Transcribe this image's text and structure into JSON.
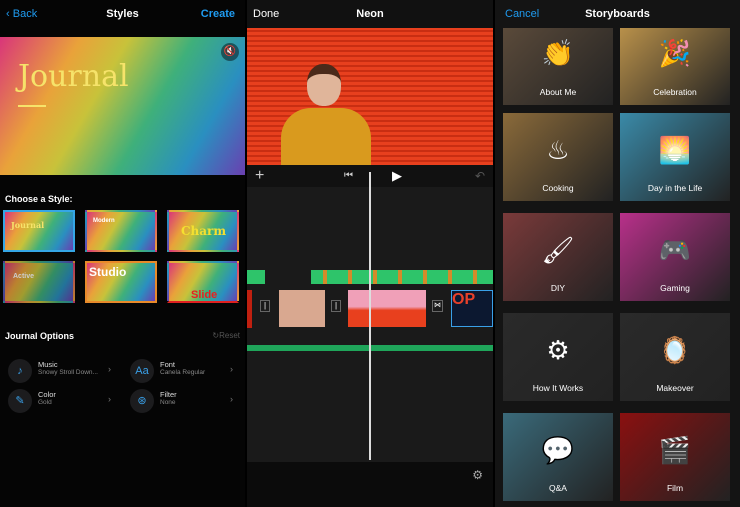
{
  "left": {
    "back": "Back",
    "title": "Styles",
    "create": "Create",
    "hero_title": "Journal",
    "choose_label": "Choose a Style:",
    "styles": [
      {
        "name": "Journal",
        "selected": true
      },
      {
        "name": "Modern"
      },
      {
        "name": "Charm"
      },
      {
        "name": "Active"
      },
      {
        "name": "Studio"
      },
      {
        "name": "Slide"
      }
    ],
    "options_title": "Journal Options",
    "reset": "Reset",
    "options": [
      {
        "label": "Music",
        "value": "Snowy Stroll Down...",
        "icon": "music-note-icon"
      },
      {
        "label": "Font",
        "value": "Canela Regular",
        "icon": "Aa"
      },
      {
        "label": "Color",
        "value": "Gold",
        "icon": "eyedropper-icon"
      },
      {
        "label": "Filter",
        "value": "None",
        "icon": "filter-icon"
      }
    ]
  },
  "mid": {
    "done": "Done",
    "title": "Neon"
  },
  "right": {
    "cancel": "Cancel",
    "title": "Storyboards",
    "items": [
      {
        "label": "About Me",
        "icon": "👏"
      },
      {
        "label": "Celebration",
        "icon": "🎉"
      },
      {
        "label": "Cooking",
        "icon": "♨"
      },
      {
        "label": "Day in the Life",
        "icon": "🌅"
      },
      {
        "label": "DIY",
        "icon": "🖌"
      },
      {
        "label": "Gaming",
        "icon": "🎮"
      },
      {
        "label": "How It Works",
        "icon": "⚙"
      },
      {
        "label": "Makeover",
        "icon": "🪞"
      },
      {
        "label": "Q&A",
        "icon": "💬"
      },
      {
        "label": "Film",
        "icon": "🎬"
      }
    ]
  }
}
